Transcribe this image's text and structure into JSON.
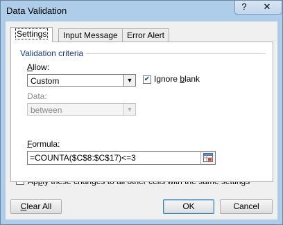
{
  "window": {
    "title": "Data Validation",
    "help_label": "?",
    "close_label": "✕"
  },
  "tabs": [
    {
      "label": "Settings",
      "active": true
    },
    {
      "label": "Input Message",
      "active": false
    },
    {
      "label": "Error Alert",
      "active": false
    }
  ],
  "settings": {
    "group_label": "Validation criteria",
    "allow_label_key": "A",
    "allow_label_rest": "llow:",
    "allow_value": "Custom",
    "ignore_blank_label_pre": "Ignore ",
    "ignore_blank_label_key": "b",
    "ignore_blank_label_post": "lank",
    "ignore_blank_checked": true,
    "data_label": "Data:",
    "data_value": "between",
    "formula_label_key": "F",
    "formula_label_rest": "ormula:",
    "formula_value": "=COUNTA($C$8:$C$17)<=3",
    "apply_label_pre": "Ap",
    "apply_label_key": "p",
    "apply_label_post": "ly these changes to all other cells with the same settings",
    "apply_checked": false
  },
  "buttons": {
    "clear_all_key": "C",
    "clear_all_rest": "lear All",
    "ok": "OK",
    "cancel": "Cancel"
  },
  "icons": {
    "dropdown": "chevron-down-icon",
    "range": "range-select-icon",
    "check": "checkmark-icon"
  }
}
